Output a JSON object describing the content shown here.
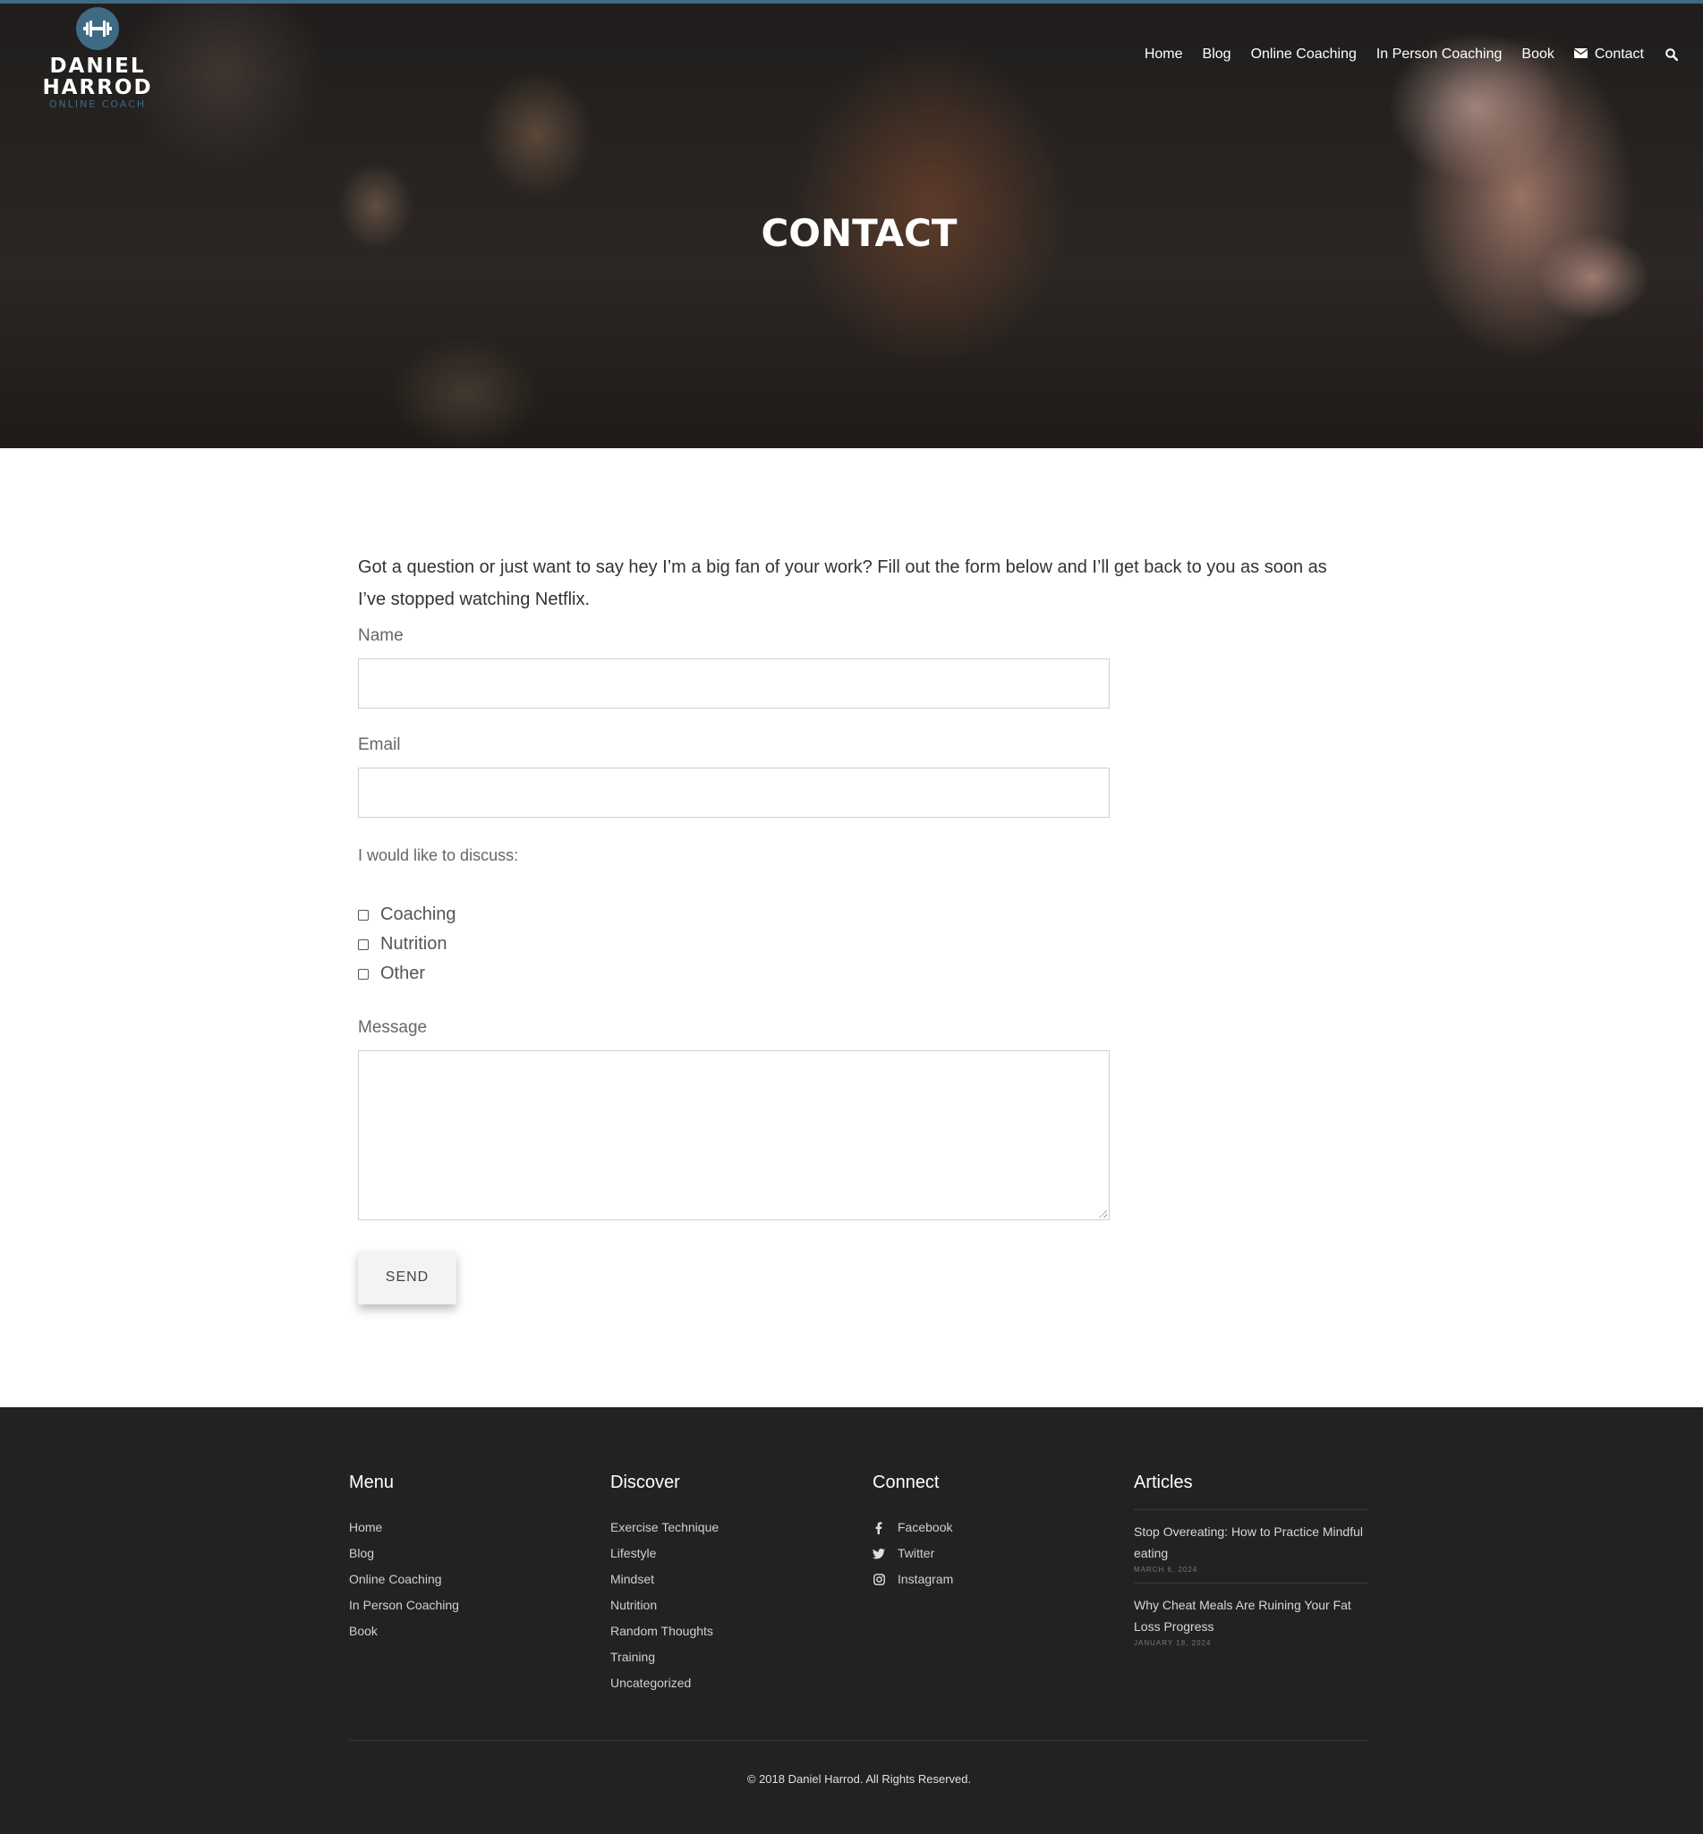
{
  "brand": {
    "line1": "DANIEL",
    "line2": "HARROD",
    "tagline": "ONLINE COACH",
    "accent_color": "#3f6a83"
  },
  "nav": {
    "items": [
      "Home",
      "Blog",
      "Online Coaching",
      "In Person Coaching",
      "Book",
      "Contact"
    ],
    "contact_icon": "envelope-icon",
    "search_icon": "search-icon"
  },
  "hero": {
    "title": "CONTACT"
  },
  "form": {
    "intro": "Got a question or just want to say hey I’m a big fan of your work? Fill out the form below and I’ll get back to you as soon as I’ve stopped watching Netflix.",
    "name_label": "Name",
    "name_value": "",
    "email_label": "Email",
    "email_value": "",
    "discuss_label": "I would like to discuss:",
    "options": [
      "Coaching",
      "Nutrition",
      "Other"
    ],
    "message_label": "Message",
    "message_value": "",
    "send_label": "SEND"
  },
  "footer": {
    "menu": {
      "heading": "Menu",
      "items": [
        "Home",
        "Blog",
        "Online Coaching",
        "In Person Coaching",
        "Book"
      ]
    },
    "discover": {
      "heading": "Discover",
      "items": [
        "Exercise Technique",
        "Lifestyle",
        "Mindset",
        "Nutrition",
        "Random Thoughts",
        "Training",
        "Uncategorized"
      ]
    },
    "connect": {
      "heading": "Connect",
      "items": [
        {
          "label": "Facebook",
          "icon": "facebook-icon"
        },
        {
          "label": "Twitter",
          "icon": "twitter-icon"
        },
        {
          "label": "Instagram",
          "icon": "instagram-icon"
        }
      ]
    },
    "articles": {
      "heading": "Articles",
      "items": [
        {
          "title": "Stop Overeating: How to Practice Mindful eating",
          "date": "MARCH 6, 2024"
        },
        {
          "title": "Why Cheat Meals Are Ruining Your Fat Loss Progress",
          "date": "JANUARY 18, 2024"
        }
      ]
    },
    "copyright": "© 2018 Daniel Harrod.   All Rights Reserved."
  }
}
